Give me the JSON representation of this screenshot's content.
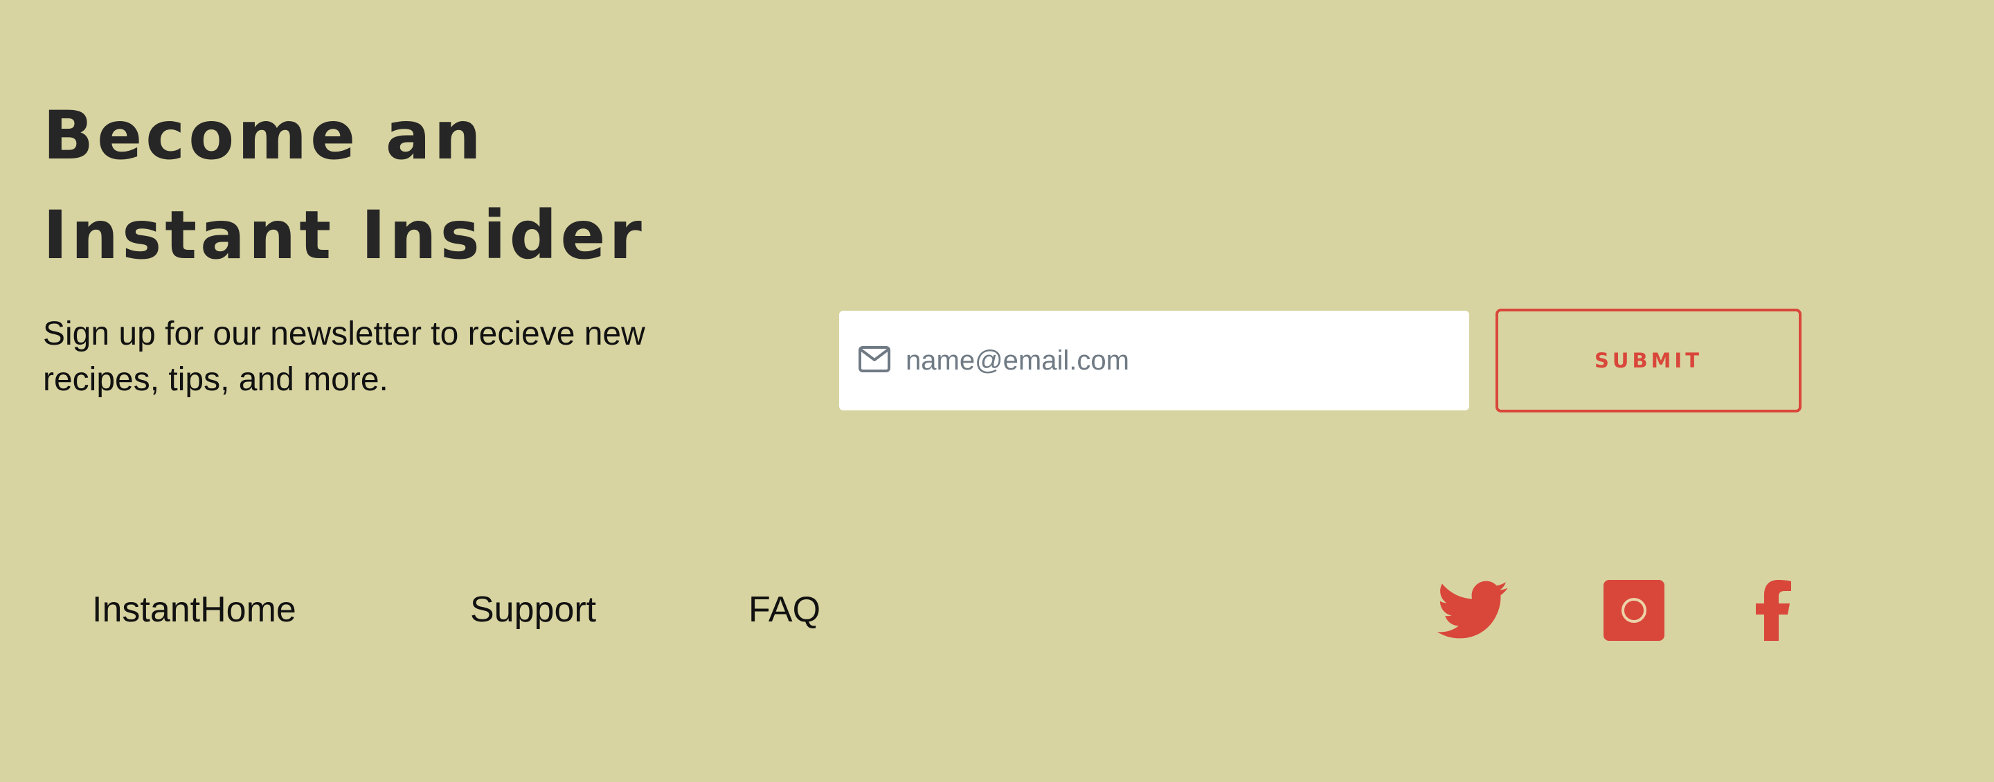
{
  "newsletter": {
    "heading_line1": "Become an",
    "heading_line2": "Instant Insider",
    "description_line1": "Sign up for our newsletter to recieve new",
    "description_line2": "recipes, tips, and more.",
    "email_placeholder": "name@email.com",
    "email_value": "",
    "email_icon": "mail-icon",
    "submit_label": "SUBMIT"
  },
  "footer": {
    "links": [
      {
        "label": "InstantHome"
      },
      {
        "label": "Support"
      },
      {
        "label": "FAQ"
      }
    ],
    "social": [
      {
        "icon": "twitter-icon"
      },
      {
        "icon": "instagram-icon"
      },
      {
        "icon": "facebook-icon"
      }
    ]
  },
  "colors": {
    "background": "#d8d4a1",
    "accent": "#d9463a",
    "heading": "#262626",
    "input_background": "#ffffff",
    "placeholder": "#6f7a84"
  }
}
